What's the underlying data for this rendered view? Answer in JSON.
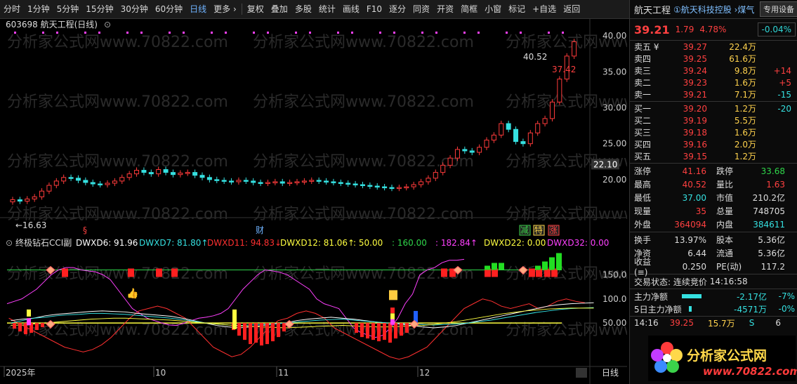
{
  "toolbar": {
    "items": [
      "分时",
      "1分钟",
      "5分钟",
      "15分钟",
      "30分钟",
      "60分钟",
      "日线",
      "更多 ›",
      "复权",
      "叠加",
      "多股",
      "统计",
      "画线",
      "F10",
      "逐分",
      "同资",
      "开资",
      "简框",
      "小窗",
      "标记",
      "+自选",
      "返回"
    ],
    "active": "日线"
  },
  "stock": {
    "code_title": "603698 航天工程(日线)",
    "name": "航天工程",
    "tag": "①航天科技控股 ›煤气",
    "btn": "专用设备",
    "price": "39.21",
    "change": "1.79",
    "change_pct": "4.78%",
    "box_pct": "-0.04%"
  },
  "orderbook": [
    {
      "label": "卖五 ¥",
      "price": "39.27",
      "vol": "22.4万",
      "delta": ""
    },
    {
      "label": "卖四",
      "price": "39.25",
      "vol": "61.6万",
      "delta": ""
    },
    {
      "label": "卖三",
      "price": "39.24",
      "vol": "9.8万",
      "delta": "+14"
    },
    {
      "label": "卖二",
      "price": "39.23",
      "vol": "1.6万",
      "delta": "+5"
    },
    {
      "label": "卖一",
      "price": "39.21",
      "vol": "7.1万",
      "delta": "-15"
    },
    {
      "label": "买一",
      "price": "39.20",
      "vol": "1.2万",
      "delta": "-20"
    },
    {
      "label": "买二",
      "price": "39.19",
      "vol": "5.5万",
      "delta": ""
    },
    {
      "label": "买三",
      "price": "39.18",
      "vol": "1.6万",
      "delta": ""
    },
    {
      "label": "买四",
      "price": "39.16",
      "vol": "2.0万",
      "delta": ""
    },
    {
      "label": "买五",
      "price": "39.15",
      "vol": "1.2万",
      "delta": ""
    }
  ],
  "stats": [
    {
      "k": "涨停",
      "v": "41.16",
      "k2": "跌停",
      "v2": "33.68"
    },
    {
      "k": "最高",
      "v": "40.52",
      "k2": "量比",
      "v2": "1.63"
    },
    {
      "k": "最低",
      "v": "37.00",
      "k2": "市值",
      "v2": "210.2亿"
    },
    {
      "k": "现量",
      "v": "35",
      "k2": "总量",
      "v2": "748705"
    },
    {
      "k": "外盘",
      "v": "364094",
      "k2": "内盘",
      "v2": "384611"
    }
  ],
  "stats2": [
    {
      "k": "换手",
      "v": "13.97%",
      "k2": "股本",
      "v2": "5.36亿"
    },
    {
      "k": "净资",
      "v": "6.44",
      "k2": "流通",
      "v2": "5.36亿"
    },
    {
      "k": "收益(≡)",
      "v": "0.250",
      "k2": "PE(动)",
      "v2": "117.2"
    }
  ],
  "status": {
    "label": "交易状态:",
    "value": "连续竞价",
    "time": "14:16:58"
  },
  "flows": [
    {
      "label": "主力净额",
      "value": "-2.17亿",
      "pct": "-7%"
    },
    {
      "label": "5日主力净额",
      "value": "-4571万",
      "pct": "-0%"
    }
  ],
  "tick": {
    "time": "14:16",
    "price": "39.25",
    "vol": "15.7万",
    "side": "S",
    "n": "6"
  },
  "indicator": {
    "name": "终极钻石CCI副",
    "items": [
      {
        "label": "DWXD6: 91.96",
        "color": "#ffffff"
      },
      {
        "label": "DWXD7: 81.80↑",
        "color": "#35e0e0"
      },
      {
        "label": "DWXD11: 94.83↓",
        "color": "#ff3030"
      },
      {
        "label": "DWXD12: 81.06↑",
        "color": "#ffff40"
      },
      {
        "label": ": 50.00",
        "color": "#ffff40"
      },
      {
        "label": ": 160.00",
        "color": "#2fd64a"
      },
      {
        "label": ": 182.84↑",
        "color": "#ff40ff"
      },
      {
        "label": "DWXD22: 0.00",
        "color": "#ffff40"
      },
      {
        "label": "DWXD32: 0.00",
        "color": "#ff40ff"
      }
    ],
    "ticks": [
      "150.0",
      "100.0",
      "50.00"
    ]
  },
  "price_axis": {
    "ticks": [
      "40.00",
      "35.00",
      "30.00",
      "25.00",
      "20.00"
    ],
    "current": "22.10"
  },
  "annotations": {
    "high": "40.52",
    "high2": "37.42",
    "low": "16.63"
  },
  "markers": {
    "s1": "§",
    "cai": "财",
    "jian": "减",
    "te": "特",
    "zhang": "涨"
  },
  "x_labels": [
    "2025年",
    "10",
    "11",
    "12"
  ],
  "bottom_tab": "日线",
  "logo": {
    "t1": "分析家公式网",
    "t2": "www.70822.com"
  },
  "watermark": "分析家公式网www.70822.com",
  "chart_data": {
    "type": "candlestick",
    "closes": [
      17.2,
      17.0,
      17.3,
      17.6,
      18.4,
      19.2,
      19.8,
      20.3,
      20.2,
      19.9,
      19.6,
      19.4,
      19.3,
      19.5,
      19.8,
      20.3,
      20.8,
      21.3,
      21.0,
      20.8,
      21.4,
      21.0,
      20.7,
      20.9,
      21.0,
      20.6,
      20.3,
      20.0,
      19.9,
      19.8,
      19.7,
      19.9,
      19.8,
      19.6,
      19.5,
      19.6,
      19.7,
      19.5,
      19.6,
      19.7,
      19.8,
      19.9,
      19.8,
      19.7,
      19.6,
      19.5,
      19.4,
      19.3,
      19.2,
      19.1,
      19.0,
      18.9,
      18.8,
      18.9,
      19.0,
      19.3,
      19.7,
      20.2,
      21.0,
      22.0,
      23.0,
      24.2,
      24.0,
      23.8,
      24.5,
      25.5,
      26.2,
      27.8,
      27.0,
      25.3,
      25.0,
      26.5,
      27.8,
      28.5,
      30.8,
      34.0,
      37.2,
      39.2
    ],
    "ylim": [
      15,
      41
    ]
  }
}
